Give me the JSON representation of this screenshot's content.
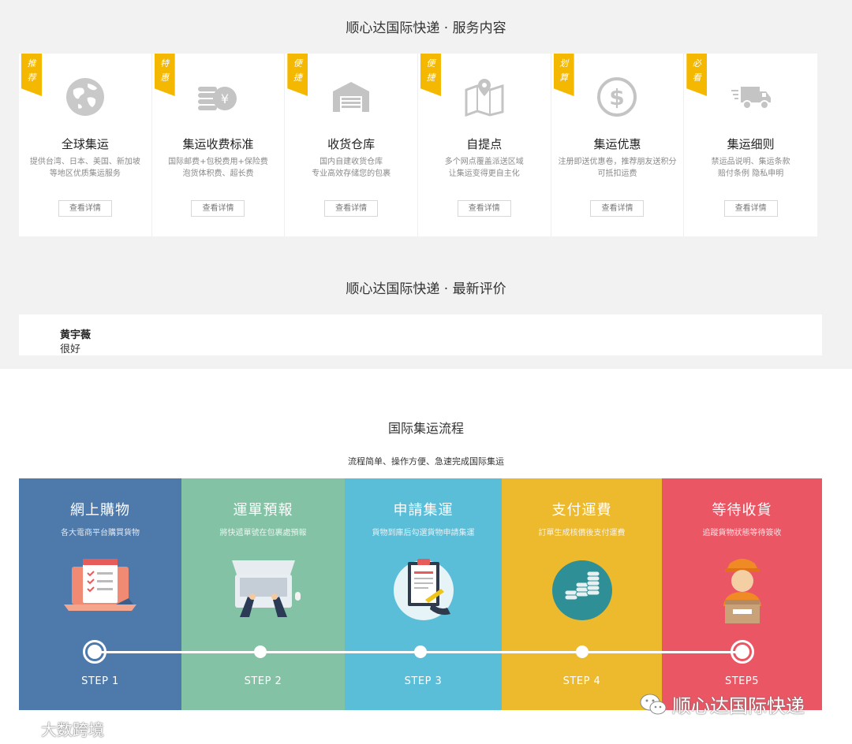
{
  "services": {
    "title": "顺心达国际快递 · 服务内容",
    "cards": [
      {
        "ribbon": [
          "推",
          "荐"
        ],
        "icon": "globe-icon",
        "title": "全球集运",
        "desc": [
          "提供台湾、日本、美国、新加坡",
          "等地区优质集运服务"
        ],
        "button": "查看详情"
      },
      {
        "ribbon": [
          "特",
          "惠"
        ],
        "icon": "coins-yen-icon",
        "title": "集运收费标准",
        "desc": [
          "国际邮费+包税费用+保险费",
          "泡货体积费、超长费"
        ],
        "button": "查看详情"
      },
      {
        "ribbon": [
          "便",
          "捷"
        ],
        "icon": "warehouse-icon",
        "title": "收货仓库",
        "desc": [
          "国内自建收货仓库",
          "专业高效存储您的包裹"
        ],
        "button": "查看详情"
      },
      {
        "ribbon": [
          "便",
          "捷"
        ],
        "icon": "map-pin-icon",
        "title": "自提点",
        "desc": [
          "多个网点覆盖派送区域",
          "让集运变得更自主化"
        ],
        "button": "查看详情"
      },
      {
        "ribbon": [
          "划",
          "算"
        ],
        "icon": "dollar-icon",
        "title": "集运优惠",
        "desc": [
          "注册即送优惠卷，推荐朋友送积分",
          "可抵扣运费"
        ],
        "button": "查看详情"
      },
      {
        "ribbon": [
          "必",
          "看"
        ],
        "icon": "truck-icon",
        "title": "集运细则",
        "desc": [
          "禁运品说明、集运条款",
          "赔付条例 隐私申明"
        ],
        "button": "查看详情"
      }
    ]
  },
  "reviews": {
    "title": "顺心达国际快递 · 最新评价",
    "items": [
      {
        "name": "黄宇薇",
        "text": "很好"
      }
    ]
  },
  "flow": {
    "title": "国际集运流程",
    "subtitle": "流程简单、操作方便、急速完成国际集运",
    "steps": [
      {
        "title": "網上購物",
        "desc": "各大電商平台購買貨物",
        "label": "STEP 1",
        "color": "#4e79ab",
        "icon": "shopping-list-laptop-icon"
      },
      {
        "title": "運單預報",
        "desc": "將快遞單號在包裹處預報",
        "label": "STEP 2",
        "color": "#83c2a4",
        "icon": "laptop-typing-icon"
      },
      {
        "title": "申請集運",
        "desc": "貨物到庫后勾選貨物申請集運",
        "label": "STEP 3",
        "color": "#5bbed9",
        "icon": "clipboard-sign-icon"
      },
      {
        "title": "支付運費",
        "desc": "訂單生成核價後支付運費",
        "label": "STEP 4",
        "color": "#edb92d",
        "icon": "coin-stack-icon"
      },
      {
        "title": "等待收貨",
        "desc": "追蹤貨物狀態等待簽收",
        "label": "STEP5",
        "color": "#eb5665",
        "icon": "delivery-man-icon"
      }
    ]
  },
  "watermarks": {
    "right": "顺心达国际快递",
    "left": "大数跨境"
  }
}
